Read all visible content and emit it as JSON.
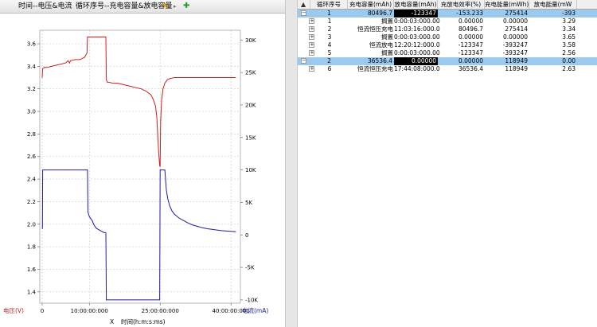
{
  "tabs": [
    {
      "label": "时间--电压&电流"
    },
    {
      "label": "循环序号--充电容量&放电容量"
    }
  ],
  "tab_icons": {
    "star": "star-icon",
    "arrow": "play-arrow-icon",
    "add": "add-icon"
  },
  "chart_data": {
    "type": "line",
    "xlabel": "时间(h:m:s:ms)",
    "x_prefix": "X",
    "ylabel_left": "电压(V)",
    "ylabel_right": "电流(mA)",
    "x_ticks": [
      "0",
      "10:00:00:000",
      "25:00:00:000",
      "40:00:00:000"
    ],
    "x_tick_hours": [
      0,
      10,
      25,
      40
    ],
    "xlim_hours": [
      -0.5,
      42
    ],
    "y_left_ticks": [
      "3.6",
      "3.4",
      "3.2",
      "3.0",
      "2.8",
      "2.6",
      "2.4",
      "2.2",
      "2.0",
      "1.8",
      "1.6",
      "1.4"
    ],
    "y_left_lim": [
      1.3,
      3.72
    ],
    "y_right_ticks": [
      "30K",
      "25K",
      "20K",
      "15K",
      "10K",
      "5K",
      "0",
      "-5K",
      "-10K"
    ],
    "y_right_lim": [
      -10500,
      31500
    ],
    "colors": {
      "voltage": "#d02020",
      "current": "#1c1ca8",
      "grid": "#c8c8c8"
    },
    "series": [
      {
        "name": "电压",
        "axis": "left",
        "x": [
          0,
          0.1,
          0.5,
          1,
          2,
          3,
          4,
          5,
          5.5,
          5.8,
          6,
          7,
          8,
          9,
          9.5,
          9.6,
          9.7,
          10,
          11,
          12,
          13,
          13.5,
          13.6,
          13.8,
          14,
          15,
          16,
          17,
          18,
          19,
          20,
          21,
          22,
          23,
          23.5,
          24,
          24.3,
          24.5,
          24.7,
          24.9,
          25.0,
          25.1,
          25.3,
          25.6,
          26,
          26.5,
          27,
          28,
          30,
          35,
          40,
          41
        ],
        "y": [
          3.3,
          3.38,
          3.39,
          3.39,
          3.4,
          3.41,
          3.42,
          3.43,
          3.45,
          3.43,
          3.45,
          3.46,
          3.46,
          3.48,
          3.52,
          3.66,
          3.66,
          3.66,
          3.66,
          3.66,
          3.66,
          3.66,
          3.28,
          3.26,
          3.26,
          3.25,
          3.25,
          3.24,
          3.23,
          3.22,
          3.21,
          3.2,
          3.18,
          3.15,
          3.11,
          3.05,
          2.95,
          2.78,
          2.63,
          2.52,
          2.51,
          2.9,
          3.1,
          3.2,
          3.25,
          3.28,
          3.29,
          3.3,
          3.3,
          3.3,
          3.3,
          3.3
        ]
      },
      {
        "name": "电流",
        "axis": "right",
        "x": [
          0,
          0.05,
          0.1,
          5,
          9.5,
          9.6,
          9.7,
          10,
          10.3,
          10.6,
          11,
          11.5,
          12,
          12.5,
          13,
          13.5,
          13.6,
          13.7,
          23.5,
          24.9,
          25.0,
          25.05,
          25.1,
          26,
          26.3,
          26.6,
          27,
          27.5,
          28,
          29,
          30,
          31,
          32,
          33,
          34,
          35,
          36,
          37,
          38,
          39,
          40,
          41
        ],
        "y": [
          1000,
          1000,
          10000,
          10000,
          10000,
          10000,
          3500,
          2800,
          2500,
          2200,
          1500,
          1000,
          800,
          600,
          400,
          300,
          -10000,
          -10000,
          -10000,
          -10000,
          10000,
          10000,
          10000,
          10000,
          7000,
          5600,
          4500,
          3700,
          3200,
          2600,
          2200,
          1800,
          1500,
          1300,
          1100,
          950,
          850,
          750,
          650,
          600,
          550,
          500
        ]
      }
    ]
  },
  "table": {
    "columns": [
      "",
      "循环序号",
      "充电容量(mAh)",
      "放电容量(mAh)",
      "充放电效率(%)",
      "充电能量(mWh)",
      "放电能量(mW"
    ],
    "rows": [
      {
        "level": 0,
        "expander": "⊟",
        "selected": true,
        "c1": "1",
        "c2": "80496.7",
        "c3": "-123347",
        "c4": "-153.233",
        "c5": "275414",
        "c6": "-393",
        "black": true
      },
      {
        "level": 1,
        "expander": "⊞",
        "selected": false,
        "c1": "1",
        "c1b": "搁置",
        "c2": "0:00:03:000.000",
        "c3": "0.00000",
        "c4": "0.00000",
        "c5": "0.00000",
        "c6": "3.29"
      },
      {
        "level": 1,
        "expander": "⊞",
        "selected": false,
        "c1": "2",
        "c1b": "恒流恒压充电",
        "c2": "11:03:16:000.000",
        "c3": "80496.7",
        "c4": "275414",
        "c5": "",
        "c6": "3.34"
      },
      {
        "level": 1,
        "expander": "⊞",
        "selected": false,
        "c1": "3",
        "c1b": "搁置",
        "c2": "0:00:03:000.000",
        "c3": "0.00000",
        "c4": "0.00000",
        "c5": "",
        "c6": "3.65"
      },
      {
        "level": 1,
        "expander": "⊞",
        "selected": false,
        "c1": "4",
        "c1b": "恒流放电",
        "c2": "12:20:12:000.000",
        "c3": "-123347",
        "c4": "-393247",
        "c5": "",
        "c6": "3.58"
      },
      {
        "level": 1,
        "expander": "⊞",
        "selected": false,
        "c1": "5",
        "c1b": "搁置",
        "c2": "0:00:03:000.000",
        "c3": "-123347",
        "c4": "-393247",
        "c5": "",
        "c6": "2.56"
      },
      {
        "level": 0,
        "expander": "⊟",
        "selected": true,
        "c1": "2",
        "c2": "36536.4",
        "c3": "0.00000",
        "c4": "0.00000",
        "c5": "118949",
        "c6": "0.00",
        "black": true
      },
      {
        "level": 1,
        "expander": "⊞",
        "selected": false,
        "c1": "6",
        "c1b": "恒流恒压充电",
        "c2": "17:44:08:000.000",
        "c3": "36536.4",
        "c4": "118949",
        "c5": "",
        "c6": "2.63"
      }
    ]
  }
}
